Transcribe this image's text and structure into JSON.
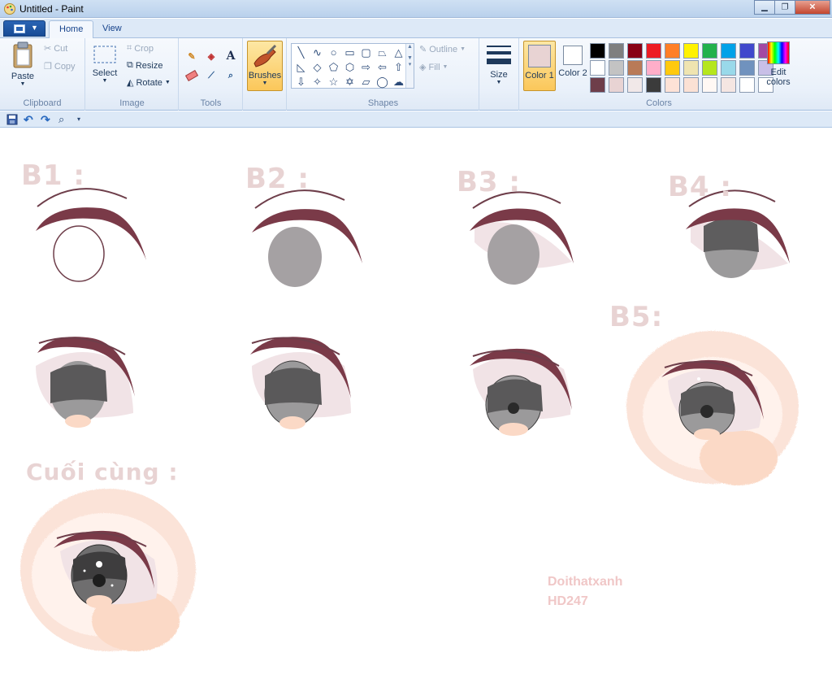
{
  "window": {
    "title": "Untitled - Paint"
  },
  "tabs": {
    "home": "Home",
    "view": "View"
  },
  "clipboard": {
    "label": "Clipboard",
    "paste": "Paste",
    "cut": "Cut",
    "copy": "Copy"
  },
  "image": {
    "label": "Image",
    "select": "Select",
    "crop": "Crop",
    "resize": "Resize",
    "rotate": "Rotate"
  },
  "tools": {
    "label": "Tools",
    "text_tool": "A"
  },
  "brushes": {
    "label": "Brushes"
  },
  "shapes": {
    "label": "Shapes",
    "outline": "Outline",
    "fill": "Fill"
  },
  "size": {
    "label": "Size"
  },
  "colors": {
    "label": "Colors",
    "color1": "Color 1",
    "color2": "Color 2",
    "edit": "Edit colors",
    "color1_value": "#e8d3d3",
    "color2_value": "#ffffff",
    "palette": [
      "#000000",
      "#7f7f7f",
      "#880015",
      "#ed1c24",
      "#ff7f27",
      "#fff200",
      "#22b14c",
      "#00a2e8",
      "#3f48cc",
      "#a349a4",
      "#ffffff",
      "#c3c3c3",
      "#b97a57",
      "#ffaec9",
      "#ffc90e",
      "#efe4b0",
      "#b5e61d",
      "#99d9ea",
      "#7092be",
      "#c8bfe7",
      "#6e3e4a",
      "#e8d3d3",
      "#f1e8e8",
      "#3b3b3b",
      "#fde2d6",
      "#fbe1d4",
      "#fff8f4",
      "#f5e6e2",
      "#ffffff",
      "#ffffff"
    ]
  },
  "canvas": {
    "labels": {
      "b1": "B1 :",
      "b2": "B2 :",
      "b3": "B3 :",
      "b4": "B4 :",
      "b5": "B5:",
      "final": "Cuối cùng :"
    },
    "watermark": {
      "line1": "Doithatxanh",
      "line2": "HD247"
    }
  }
}
